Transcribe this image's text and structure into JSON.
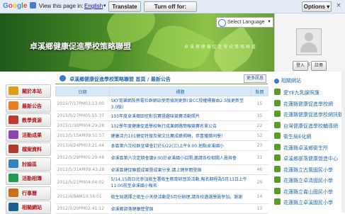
{
  "translate_bar": {
    "logo": "Google",
    "view_text": "View this page in:",
    "language": "English",
    "translate_label": "Translate",
    "turn_off_label": "Turn off for: Chinese",
    "options_label": "Options ▾",
    "close": "×"
  },
  "banner": {
    "title": "卓溪鄉健康促進學校策略聯盟",
    "subtitle": "卓 溪 鄉 健 康 促 進 學 校 策 略 聯 盟",
    "select_language": "Select Language",
    "select_arrow": "▼"
  },
  "login": {
    "visitor": "訪客",
    "login_label": "登入",
    "register_label": "註冊"
  },
  "nav": {
    "items": [
      {
        "label": "關於本站",
        "color": "#d9a017"
      },
      {
        "label": "最新公告",
        "color": "#e67e22"
      },
      {
        "label": "教學資源",
        "color": "#c0392b"
      },
      {
        "label": "活動成果",
        "color": "#8e44ad"
      },
      {
        "label": "檔案資料",
        "color": "#b03a2e"
      },
      {
        "label": "討論區",
        "color": "#2e86c1"
      },
      {
        "label": "活動相簿",
        "color": "#229954"
      },
      {
        "label": "行事曆",
        "color": "#ca6f1e"
      },
      {
        "label": "相關網站",
        "color": "#1f618d"
      }
    ]
  },
  "main": {
    "breadcrumb": "卓溪鄉健康促進學校策略聯盟 首頁 / 最新公告",
    "more_label": "更多訊息",
    "columns": [
      "日期",
      "標題",
      "點閱"
    ],
    "rows": [
      {
        "date": "2015/7/17PM03:13:00",
        "title": "SKY育樂網及熱電社群網站使用偵測更新(含CC授權標籤由2.5版更新至3.0版)",
        "count": "15"
      },
      {
        "date": "2015/5/27PM05:55:37",
        "title": "103年度卓溪鄉田徑對抗賽暨趣味競賽活動照片",
        "count": "35"
      },
      {
        "date": "2015/1/30PM04:29:28",
        "title": "102學年度健康促進學校執行成果網路簡報競賽名單公告",
        "count": "22"
      },
      {
        "date": "2013/5/15AM09:51:57",
        "title": "健康活力101健促特搜及徵文比賽成績揭曉，恭喜獲獎同學！",
        "count": "52"
      },
      {
        "date": "2013/4/24PM03:21:44",
        "title": "本區第六次校群宣導會訂於5/22(三)上午9:00.地點卓溪國小",
        "count": "23"
      },
      {
        "date": "2012/5/29PM05:29:48",
        "title": "卓溪區第六次定期會議9:00於卓溪國小召開,邀請各校相關人員與會",
        "count": "31"
      },
      {
        "date": "2012/5/31AM09:43:28",
        "title": "卓溪區健促聯盟成果暨成果分享,請上網參閱登錄",
        "count": "46"
      },
      {
        "date": "2012/5/21PM04:04:02",
        "title": "5/14,15首日北參加衛生署衛生教育研習及活動,報名期程為5月13日上午11:00前至卓溪國小報名",
        "count": "29"
      },
      {
        "date": "2012/4/9AM10:16:01",
        "title": "衛生局選擇之衛生小天使活動是5月份辦理,請各校遴選學員參加。謝謝",
        "count": "14"
      },
      {
        "date": "2012/3/20PM02:41:12",
        "title": "卓溪鄉部落健康營登錄",
        "count": "13"
      }
    ]
  },
  "right": {
    "header": "相關網站",
    "links": [
      "愛YE九乳腺照護",
      "花蓮縣健康促進學校網",
      "花蓮縣健康促進學校網訊觀站",
      "台灣健康促進學校輔導網",
      "衛生局E化網",
      "花蓮縣卓溪鄉衛生所",
      "卓溪鄉部落健康營造中心",
      "花蓮縣立古風國民小學",
      "花蓮縣立卓清國民小學",
      "花蓮縣立崙山國民小學",
      "花蓮縣立卓溪國民小學"
    ]
  },
  "colors": {
    "accent": "#2c6ea8",
    "nav_text": "#b0191e",
    "table_header": "#d8e8f8",
    "banner": "#4f8f2a"
  }
}
